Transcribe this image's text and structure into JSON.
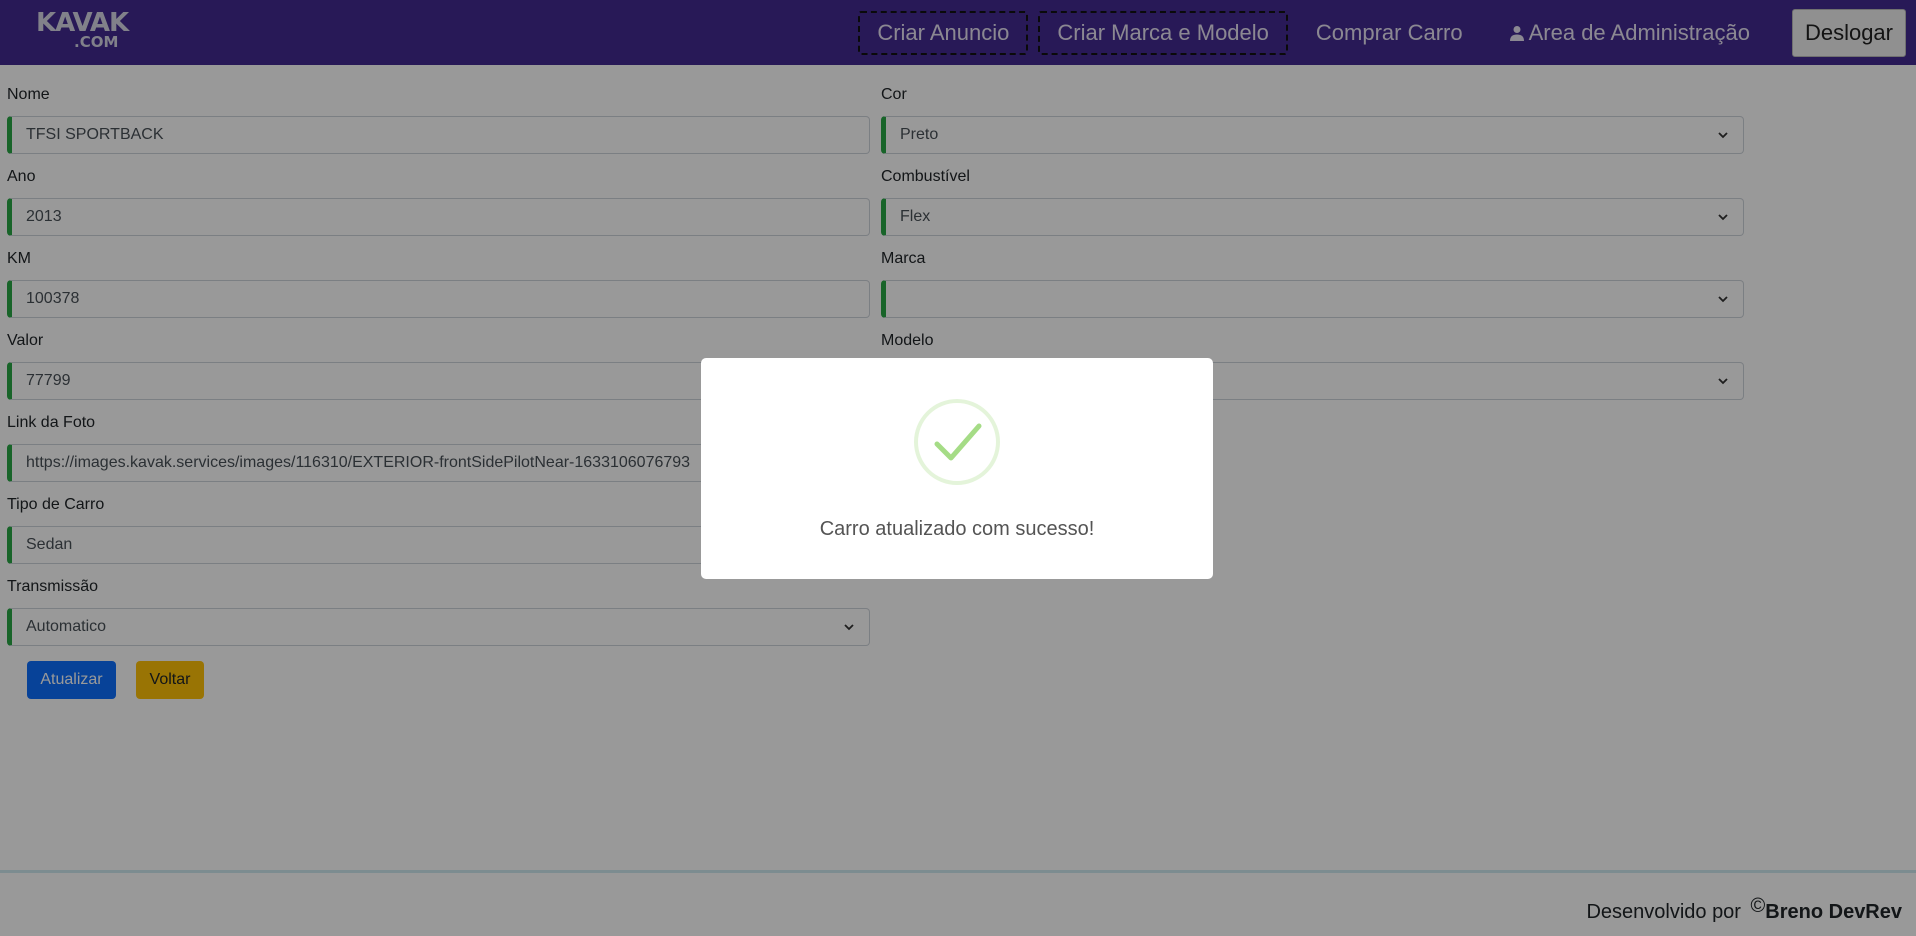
{
  "navbar": {
    "logo_main": "KAVAK",
    "logo_sub": ".COM",
    "links": {
      "create_ad": "Criar Anuncio",
      "create_brand_model": "Criar Marca e Modelo",
      "buy_car": "Comprar Carro",
      "admin_area": "Area de Administração"
    },
    "logout": "Deslogar",
    "colors": {
      "background": "#432a91"
    }
  },
  "form": {
    "left": {
      "nome": {
        "label": "Nome",
        "value": "TFSI SPORTBACK"
      },
      "ano": {
        "label": "Ano",
        "value": "2013"
      },
      "km": {
        "label": "KM",
        "value": "100378"
      },
      "valor": {
        "label": "Valor",
        "value": "77799"
      },
      "foto": {
        "label": "Link da Foto",
        "value": "https://images.kavak.services/images/116310/EXTERIOR-frontSidePilotNear-1633106076793"
      },
      "tipo": {
        "label": "Tipo de Carro",
        "value": "Sedan"
      },
      "transmissao": {
        "label": "Transmissão",
        "value": "Automatico"
      }
    },
    "right": {
      "cor": {
        "label": "Cor",
        "value": "Preto"
      },
      "combustivel": {
        "label": "Combustível",
        "value": "Flex"
      },
      "marca": {
        "label": "Marca",
        "value": ""
      },
      "modelo": {
        "label": "Modelo",
        "value": ""
      }
    },
    "buttons": {
      "update": "Atualizar",
      "back": "Voltar"
    },
    "colors": {
      "valid_border": "#28a745",
      "update_bg": "#0d6efd",
      "back_bg": "#ffc107"
    }
  },
  "footer": {
    "text": "Desenvolvido por",
    "copyright": "©",
    "author": "Breno DevRev"
  },
  "modal": {
    "icon": "success-check-icon",
    "message": "Carro atualizado com sucesso!",
    "colors": {
      "check": "#a5dc86",
      "ring": "rgba(165,220,134,0.3)"
    }
  }
}
